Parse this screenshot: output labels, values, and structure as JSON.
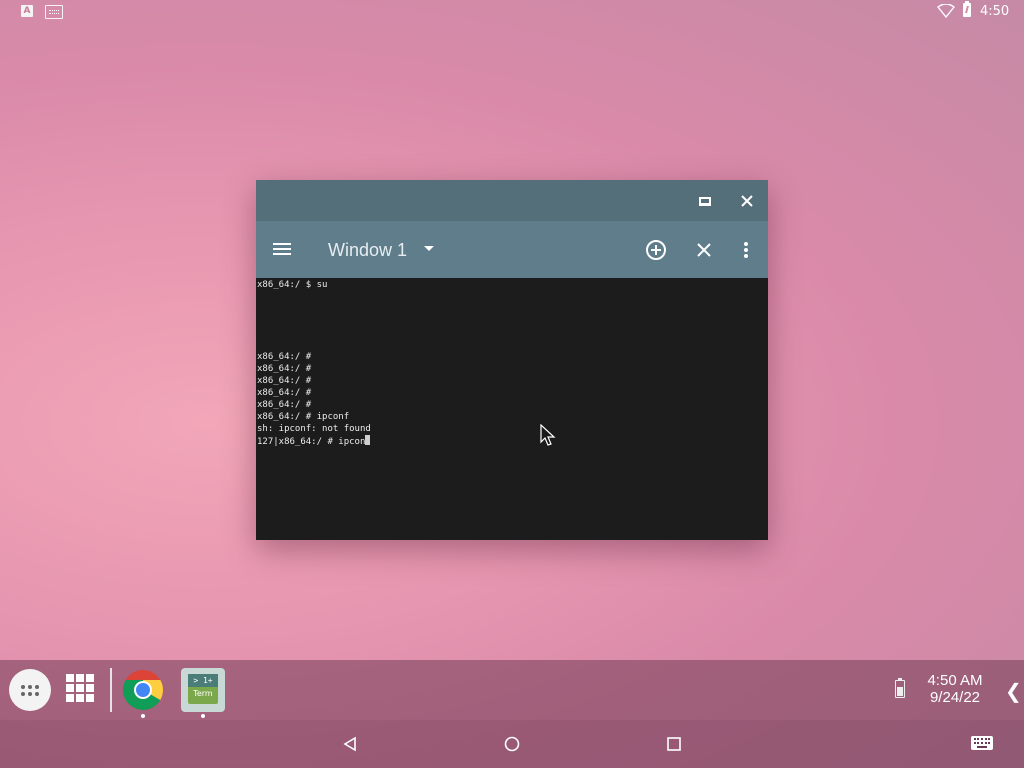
{
  "status_bar": {
    "left_icons": [
      "a-notification-icon",
      "keyboard-notification-icon"
    ],
    "a_badge": "A",
    "right_icons": [
      "wifi-icon",
      "battery-charging-icon"
    ],
    "time": "4:50"
  },
  "window": {
    "caption_buttons": [
      "maximize-icon",
      "close-icon"
    ],
    "toolbar": {
      "menu_icon": "hamburger-menu-icon",
      "title": "Window 1",
      "dropdown_icon": "dropdown-arrow-icon",
      "actions": [
        "add-window-icon",
        "close-window-icon",
        "more-options-icon"
      ]
    },
    "terminal": {
      "lines": [
        "x86_64:/ $ su",
        "",
        "",
        "",
        "",
        "",
        "x86_64:/ #",
        "x86_64:/ #",
        "x86_64:/ #",
        "x86_64:/ #",
        "x86_64:/ #",
        "x86_64:/ # ipconf",
        "sh: ipconf: not found",
        "127|x86_64:/ # ipcon"
      ]
    }
  },
  "taskbar": {
    "apps": [
      {
        "name": "app-drawer-icon"
      },
      {
        "name": "app-grid-icon"
      },
      {
        "name": "chrome-icon",
        "running": true
      },
      {
        "name": "terminal-icon",
        "running": true,
        "icon_top_text": "> 1+",
        "icon_bottom_text": "Term"
      }
    ],
    "time": "4:50 AM",
    "date": "9/24/22",
    "battery_icon": "battery-icon",
    "expand_icon": "chevron-left-icon"
  },
  "nav_bar": {
    "buttons": [
      "back-icon",
      "home-icon",
      "recents-icon"
    ],
    "keyboard_icon": "keyboard-icon"
  }
}
